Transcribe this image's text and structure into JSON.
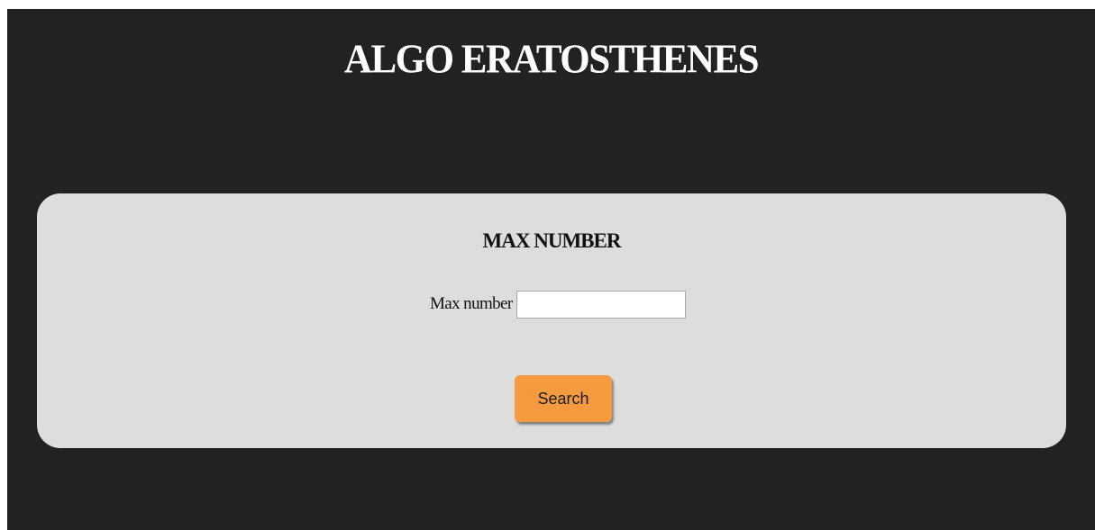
{
  "header": {
    "title": "ALGO ERATOSTHENES"
  },
  "form": {
    "heading": "MAX NUMBER",
    "max_number_label": "Max number",
    "max_number_value": "",
    "search_label": "Search"
  },
  "colors": {
    "page_background": "#222222",
    "panel_background": "#dddddd",
    "button_background": "#f59a3e",
    "title_text": "#ffffff"
  }
}
